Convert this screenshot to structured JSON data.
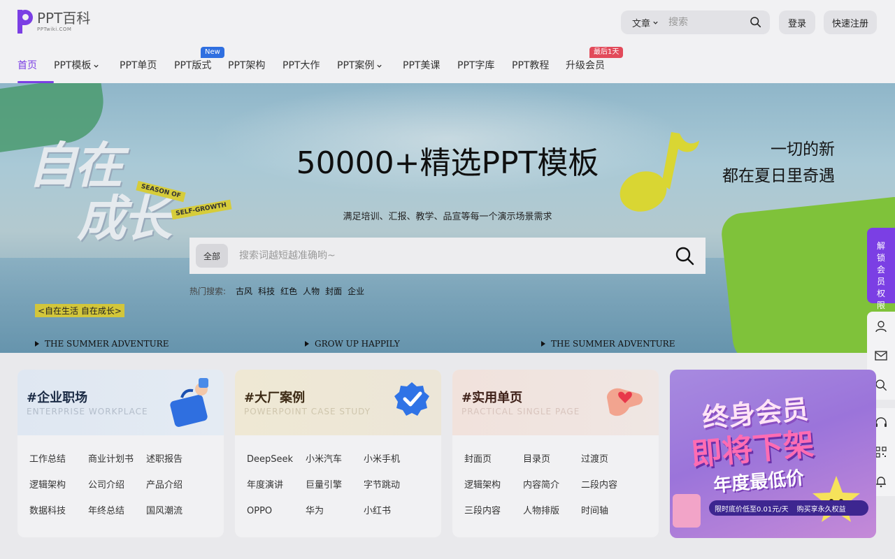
{
  "logo": {
    "title": "PPT百科",
    "sub": "PPTwiki.COM"
  },
  "search": {
    "category": "文章",
    "placeholder": "搜索"
  },
  "auth": {
    "login": "登录",
    "register": "快速注册"
  },
  "nav": [
    {
      "label": "首页"
    },
    {
      "label": "PPT模板"
    },
    {
      "label": "PPT单页"
    },
    {
      "label": "PPT版式",
      "badge": "New"
    },
    {
      "label": "PPT架构"
    },
    {
      "label": "PPT大作"
    },
    {
      "label": "PPT案例"
    },
    {
      "label": "PPT美课"
    },
    {
      "label": "PPT字库"
    },
    {
      "label": "PPT教程"
    },
    {
      "label": "升级会员",
      "badge": "最后1天"
    }
  ],
  "hero": {
    "title": "50000+精选PPT模板",
    "subtitle": "满足培训、汇报、教学、品宣等每一个演示场景需求",
    "corner_line1": "一切的新",
    "corner_line2": "都在夏日里奇遇",
    "deco_title": "自在\n成长",
    "deco_ribbon1": "SEASON OF",
    "deco_ribbon2": "SELF-GROWTH",
    "deco_tag": "<自在生活 自在成长>",
    "search_category": "全部",
    "search_placeholder": "搜索词越短越准确哟~",
    "hot_label": "热门搜索:",
    "hot": [
      "古风",
      "科技",
      "红色",
      "人物",
      "封面",
      "企业"
    ],
    "bottom": [
      "THE SUMMER ADVENTURE",
      "GROW UP HAPPILY",
      "THE SUMMER ADVENTURE"
    ]
  },
  "side": {
    "vip": "解锁会员权限"
  },
  "cards": [
    {
      "title": "#企业职场",
      "en": "ENTERPRISE WORKPLACE",
      "links": [
        "工作总结",
        "商业计划书",
        "述职报告",
        "逻辑架构",
        "公司介绍",
        "产品介绍",
        "数据科技",
        "年终总结",
        "国风潮流"
      ]
    },
    {
      "title": "#大厂案例",
      "en": "POWERPOINT CASE STUDY",
      "links": [
        "DeepSeek",
        "小米汽车",
        "小米手机",
        "年度演讲",
        "巨量引擎",
        "字节跳动",
        "OPPO",
        "华为",
        "小红书"
      ]
    },
    {
      "title": "#实用单页",
      "en": "PRACTICAL SINGLE PAGE",
      "links": [
        "封面页",
        "目录页",
        "过渡页",
        "逻辑架构",
        "内容简介",
        "二段内容",
        "三段内容",
        "人物排版",
        "时间轴"
      ]
    }
  ],
  "promo": {
    "line1": "终身会员",
    "line2": "即将下架",
    "line3": "年度最低价",
    "bar_left": "限时底价低至0.01元/天",
    "bar_right": "购买享永久权益"
  },
  "colors": {
    "brand": "#7b3fe4",
    "new_badge": "#2f6fe0",
    "last_badge": "#e24a5a"
  }
}
